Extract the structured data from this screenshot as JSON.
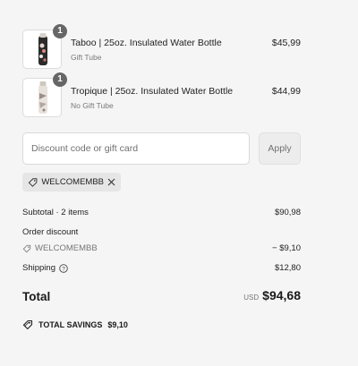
{
  "items": [
    {
      "title": "Taboo | 25oz. Insulated Water Bottle",
      "subtitle": "Gift Tube",
      "price": "$45,99",
      "quantity": "1"
    },
    {
      "title": "Tropique | 25oz. Insulated Water Bottle",
      "subtitle": "No Gift Tube",
      "price": "$44,99",
      "quantity": "1"
    }
  ],
  "discount": {
    "placeholder": "Discount code or gift card",
    "apply_label": "Apply",
    "applied_code": "WELCOMEMBB"
  },
  "summary": {
    "subtotal_label": "Subtotal · 2 items",
    "subtotal_value": "$90,98",
    "order_discount_label": "Order discount",
    "discount_code": "WELCOMEMBB",
    "discount_value": "− $9,10",
    "shipping_label": "Shipping",
    "shipping_value": "$12,80",
    "total_label": "Total",
    "currency": "USD",
    "total_value": "$94,68",
    "savings_label": "TOTAL SAVINGS",
    "savings_value": "$9,10"
  },
  "icons": {
    "tag": "tag-icon",
    "close": "close-icon",
    "help": "help-circle-icon",
    "savings": "savings-tag-icon"
  }
}
